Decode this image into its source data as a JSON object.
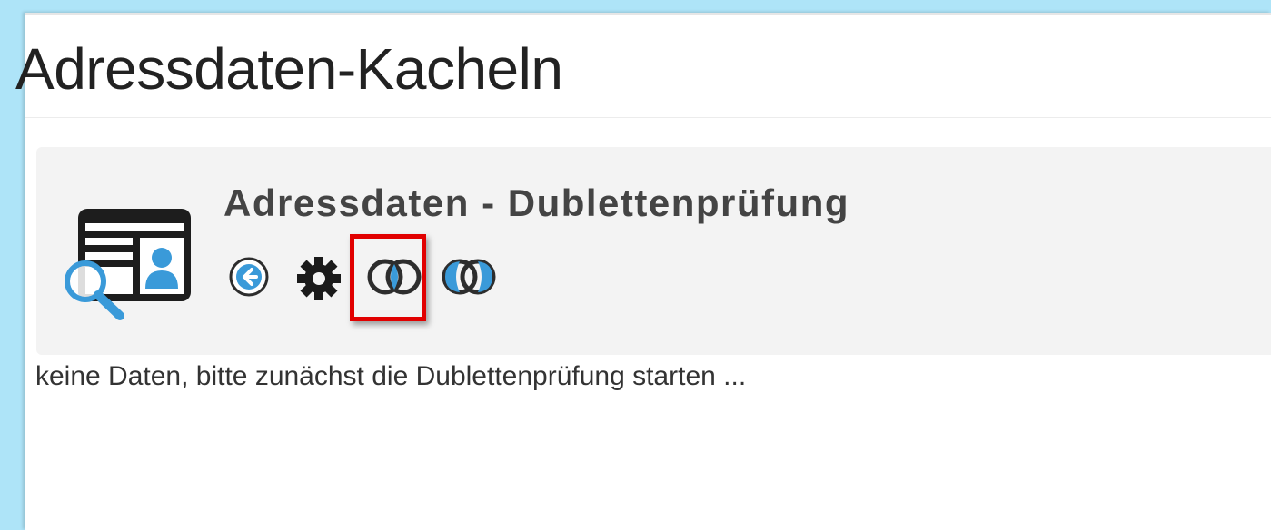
{
  "page": {
    "title": "Adressdaten-Kacheln"
  },
  "tile": {
    "title": "Adressdaten - Dublettenprüfung",
    "icon": "address-card-search-icon",
    "actions": [
      {
        "name": "back",
        "icon": "back-arrow-icon"
      },
      {
        "name": "settings",
        "icon": "gear-icon"
      },
      {
        "name": "duplicate-check-start",
        "icon": "overlapping-rings-icon",
        "highlighted": true
      },
      {
        "name": "duplicate-check-results",
        "icon": "overlapping-rings-icon"
      }
    ]
  },
  "status": {
    "message": "keine Daten, bitte zunächst die Dublettenprüfung starten ..."
  },
  "colors": {
    "accent": "#3a9ad9",
    "highlight": "#e10000",
    "tile_background": "#f3f3f3",
    "window_background": "#aee4f8"
  }
}
